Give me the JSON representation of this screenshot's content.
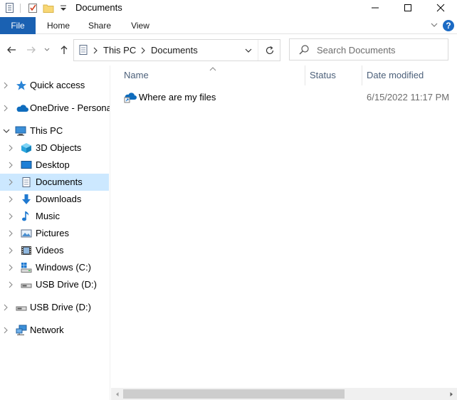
{
  "window": {
    "title": "Documents"
  },
  "ribbon": {
    "tabs": [
      {
        "label": "File"
      },
      {
        "label": "Home"
      },
      {
        "label": "Share"
      },
      {
        "label": "View"
      }
    ],
    "help_label": "?"
  },
  "address": {
    "crumbs": [
      "This PC",
      "Documents"
    ]
  },
  "search": {
    "placeholder": "Search Documents"
  },
  "navpane": {
    "items": [
      {
        "label": "Quick access",
        "icon": "star-icon"
      },
      {
        "label": "OneDrive - Personal",
        "icon": "onedrive-cloud-icon"
      },
      {
        "label": "This PC",
        "icon": "computer-icon",
        "expanded": true
      },
      {
        "label": "3D Objects",
        "icon": "cube-3d-icon"
      },
      {
        "label": "Desktop",
        "icon": "desktop-icon"
      },
      {
        "label": "Documents",
        "icon": "document-icon",
        "selected": true
      },
      {
        "label": "Downloads",
        "icon": "download-arrow-icon"
      },
      {
        "label": "Music",
        "icon": "music-note-icon"
      },
      {
        "label": "Pictures",
        "icon": "pictures-icon"
      },
      {
        "label": "Videos",
        "icon": "film-icon"
      },
      {
        "label": "Windows (C:)",
        "icon": "windows-drive-icon"
      },
      {
        "label": "USB Drive (D:)",
        "icon": "usb-drive-icon"
      },
      {
        "label": "USB Drive (D:)",
        "icon": "usb-drive-icon"
      },
      {
        "label": "Network",
        "icon": "network-icon"
      }
    ]
  },
  "columns": {
    "name": "Name",
    "status": "Status",
    "date_modified": "Date modified"
  },
  "files": [
    {
      "name": "Where are my files",
      "date_modified": "6/15/2022 11:17 PM",
      "icon": "onedrive-shortcut-icon"
    }
  ],
  "colors": {
    "accent": "#1a61b2",
    "selection": "#cce8ff",
    "column_header_text": "#4c607a"
  }
}
